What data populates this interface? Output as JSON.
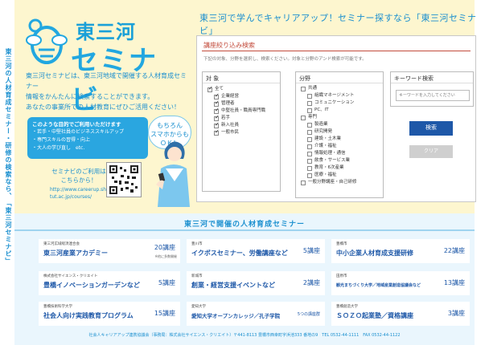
{
  "side": {
    "vertical_text": "東三河の人材育成セミナー・研修の検索なら、「東三河セミナビ」"
  },
  "header": {
    "logo_top": "東三河",
    "logo_bottom": "セミナビ",
    "tagline": "東三河で学んでキャリアアップ！セミナー探すなら「東三河セミナビ」"
  },
  "intro": {
    "lines": [
      "東三河セミナビは、東三河地域で開催する人材育成セミナー",
      "情報をかんたんに検索することができます。",
      "あなたの事業所での人材教育にぜひご活用ください！"
    ]
  },
  "benefits": {
    "title": "このような目的でご利用いただけます",
    "items": [
      "・若手・中堅社員のビジネススキルアップ",
      "・専門スキルの習得・向上",
      "・大人の学び直し　etc."
    ]
  },
  "bubble": {
    "lines": [
      "もちろん",
      "スマホからも",
      "ＯＫ！"
    ]
  },
  "access": {
    "note": [
      "セミナビのご利用は",
      "こちらから！"
    ],
    "url": [
      "http://www.careerup.sharen",
      "tut.ac.jp/courses/"
    ]
  },
  "search": {
    "title": "講座絞り込み検索",
    "desc": "下記の対象、分野を選択し、検索ください。対象と分野のアンド検索が可能です。",
    "target": {
      "label": "対 象",
      "all": "全て",
      "items": [
        "企業経営",
        "管理者",
        "中堅社員・職員専門職",
        "若手",
        "新入社員",
        "一般市民"
      ]
    },
    "field": {
      "label": "分野",
      "common_label": "共通",
      "common_items": [
        "組織マネージメント",
        "コミュニケーション",
        "PC、IT"
      ],
      "special_label": "専門",
      "special_items": [
        "製造業",
        "研究開発",
        "建設・土木業",
        "介護・福祉",
        "情報処理・通信",
        "飲食・サービス業",
        "教育・6次産業",
        "医療・福祉"
      ],
      "other": "一般分野講座・自己研修"
    },
    "keyword": {
      "label": "キーワード検索",
      "placeholder": "キーワードを入力してください"
    },
    "search_button": "検索",
    "clear_button": "クリア"
  },
  "seminars": {
    "title": "東三河で開催の人材育成セミナー",
    "cards": [
      {
        "org": "東三河広域経済連合会",
        "name": "東三河産業アカデミー",
        "count": "20講座",
        "sub": "※他に多数開催"
      },
      {
        "org": "豊川市",
        "name": "イクボスセミナー、労働講座など",
        "count": "5講座",
        "sub": ""
      },
      {
        "org": "豊橋市",
        "name": "中小企業人材育成支援研修",
        "count": "22講座",
        "sub": ""
      },
      {
        "org": "株式会社サイエンス・クリエイト",
        "name": "豊橋イノベーションガーデンなど",
        "count": "5講座",
        "sub": ""
      },
      {
        "org": "新城市",
        "name": "創業・経営支援イベントなど",
        "count": "2講座",
        "sub": ""
      },
      {
        "org": "田原市",
        "name": "観光まちづくり大学／地域産業創造協議会など",
        "count": "13講座",
        "sub": ""
      },
      {
        "org": "豊橋技術科学大学",
        "name": "社会人向け実践教育プログラム",
        "count": "15講座",
        "sub": ""
      },
      {
        "org": "愛知大学",
        "name": "愛知大学オープンカレッジ／孔子学院",
        "count": "5つの講座群",
        "sub": ""
      },
      {
        "org": "豊橋創造大学",
        "name": "ＳＯＺＯ起業塾／資格講座",
        "count": "3講座",
        "sub": ""
      }
    ]
  },
  "footer": {
    "text": "社会人キャリアアップ連携協議会（事務局：株式会社サイエンス・クリエイト）〒441-8113 豊橋市西幸町字浜池333 番地の9　TEL 0532-44-1111　FAX 0532-44-1122"
  },
  "colors": {
    "primary": "#1a8fcf",
    "button": "#1e58a8",
    "accent_red": "#c34c3c",
    "background": "#fdf6cf"
  }
}
